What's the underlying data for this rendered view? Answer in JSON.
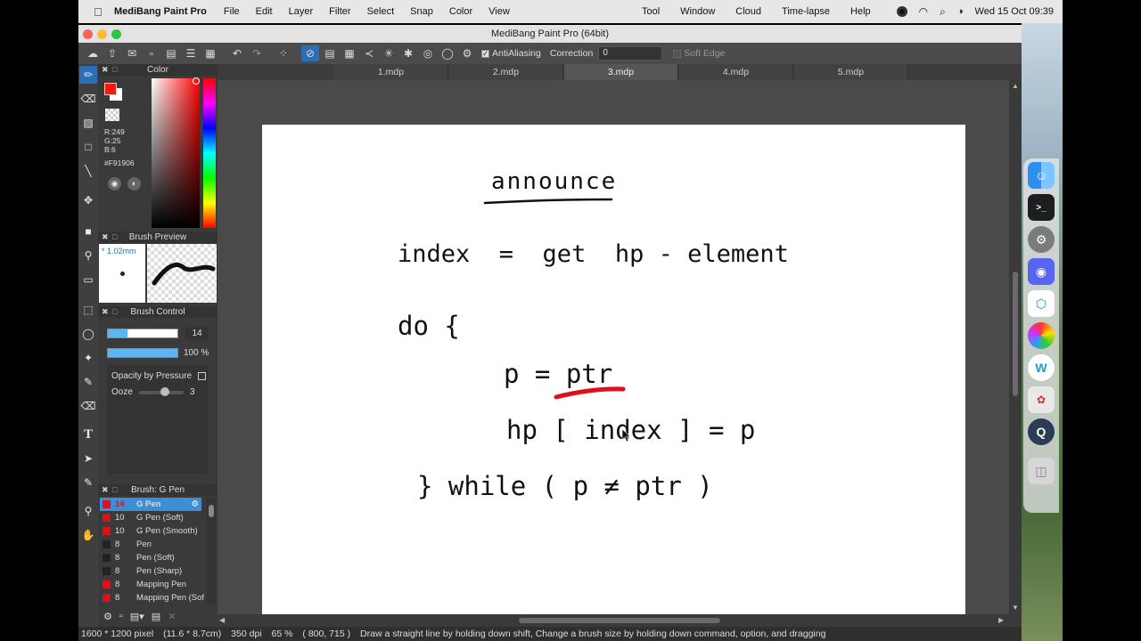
{
  "menubar": {
    "app_name": "MediBang Paint Pro",
    "items": [
      "File",
      "Edit",
      "Layer",
      "Filter",
      "Select",
      "Snap",
      "Color",
      "View"
    ],
    "right_items": [
      "Tool",
      "Window",
      "Cloud",
      "Time-lapse",
      "Help"
    ],
    "clock": "Wed 15 Oct  09:39"
  },
  "window": {
    "title": "MediBang Paint Pro (64bit)"
  },
  "toolbar": {
    "antialiasing_label": "AntiAliasing",
    "correction_label": "Correction",
    "correction_value": "0",
    "soft_edge_label": "Soft Edge"
  },
  "color_panel": {
    "title": "Color",
    "r": "R:249",
    "g": "G:25",
    "b": "B:6",
    "hex": "#F91906",
    "current_color": "#F91906"
  },
  "brush_preview": {
    "title": "Brush Preview",
    "size": "* 1.02mm"
  },
  "brush_control": {
    "title": "Brush Control",
    "size_value": "14",
    "opacity_value": "100 %",
    "opacity_by_pressure_label": "Opacity by Pressure",
    "ooze_label": "Ooze",
    "ooze_value": "3"
  },
  "brush_list": {
    "title": "Brush: G Pen",
    "items": [
      {
        "size": "14",
        "name": "G Pen",
        "color": "#e0101b"
      },
      {
        "size": "10",
        "name": "G Pen (Soft)",
        "color": "#e0101b"
      },
      {
        "size": "10",
        "name": "G Pen (Smooth)",
        "color": "#e0101b"
      },
      {
        "size": "8",
        "name": "Pen",
        "color": "#222222"
      },
      {
        "size": "8",
        "name": "Pen (Soft)",
        "color": "#222222"
      },
      {
        "size": "8",
        "name": "Pen (Sharp)",
        "color": "#222222"
      },
      {
        "size": "8",
        "name": "Mapping Pen",
        "color": "#e0101b"
      },
      {
        "size": "8",
        "name": "Mapping Pen (Sof",
        "color": "#e0101b"
      }
    ]
  },
  "tabs": [
    "1.mdp",
    "2.mdp",
    "3.mdp",
    "4.mdp",
    "5.mdp"
  ],
  "canvas": {
    "line1": "announce",
    "line2": "index  =  get  hp - element",
    "line3": "do {",
    "line4": "p = ptr",
    "line5": "hp [ index ] = p",
    "line6": "} while ( p ≠ ptr )"
  },
  "statusbar": {
    "size": "1600 * 1200 pixel",
    "cm": "(11.6 * 8.7cm)",
    "dpi": "350 dpi",
    "zoom": "65 %",
    "coords": "( 800, 715 )",
    "hint": "Draw a straight line by holding down shift, Change a brush size by holding down command, option, and dragging"
  },
  "colors": {
    "accent": "#2d6fb5",
    "highlight": "#3b8fd6",
    "stroke_red": "#e0101b"
  }
}
